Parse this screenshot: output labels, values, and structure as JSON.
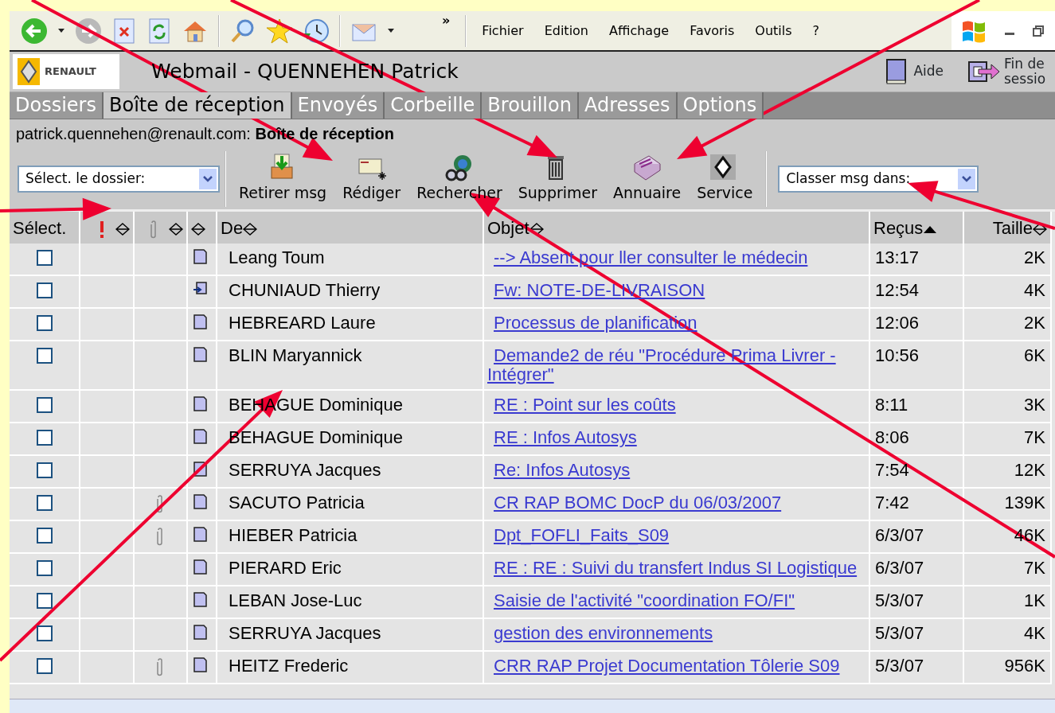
{
  "browser": {
    "menu": [
      "Fichier",
      "Edition",
      "Affichage",
      "Favoris",
      "Outils",
      "?"
    ],
    "chevron": "»"
  },
  "header": {
    "logo": "RENAULT",
    "title": "Webmail - QUENNEHEN Patrick",
    "help": "Aide",
    "logout": "Fin de sessio"
  },
  "tabs": [
    {
      "label": "Dossiers",
      "selected": false
    },
    {
      "label": "Boîte de réception",
      "selected": true
    },
    {
      "label": "Envoyés",
      "selected": false
    },
    {
      "label": "Corbeille",
      "selected": false
    },
    {
      "label": "Brouillon",
      "selected": false
    },
    {
      "label": "Adresses",
      "selected": false
    },
    {
      "label": "Options",
      "selected": false
    }
  ],
  "location": "patrick.quennehen@renault.com: **Boîte de réception**",
  "toolbar": {
    "folder_select": "Sélect. le dossier:",
    "buttons": [
      {
        "kind": "retrieve",
        "label": "Retirer msg"
      },
      {
        "kind": "compose",
        "label": "Rédiger"
      },
      {
        "kind": "search",
        "label": "Rechercher"
      },
      {
        "kind": "delete",
        "label": "Supprimer"
      },
      {
        "kind": "directory",
        "label": "Annuaire"
      },
      {
        "kind": "service",
        "label": "Service"
      }
    ],
    "move_select": "Classer msg dans:"
  },
  "table": {
    "columns": [
      {
        "kind": "select",
        "label": "Sélect."
      },
      {
        "kind": "priority",
        "sorted": false
      },
      {
        "kind": "attachment",
        "sorted": false
      },
      {
        "kind": "icon",
        "sorted": false
      },
      {
        "kind": "text",
        "label": "De",
        "sorted": false
      },
      {
        "kind": "text",
        "label": "Objet",
        "sorted": false
      },
      {
        "kind": "text",
        "label": "Reçus",
        "sorted": true
      },
      {
        "kind": "text",
        "label": "Taille",
        "sorted": false
      }
    ],
    "rows": [
      {
        "checked": false,
        "attachment": false,
        "kind": "message",
        "from": "Leang Toum",
        "subject": "--> Absent pour ller consulter le médecin",
        "received": "13:17",
        "size": "2K"
      },
      {
        "checked": false,
        "attachment": false,
        "kind": "forwarded",
        "from": "CHUNIAUD Thierry",
        "subject": "Fw: NOTE-DE-LIVRAISON",
        "received": "12:54",
        "size": "4K"
      },
      {
        "checked": false,
        "attachment": false,
        "kind": "message",
        "from": "HEBREARD Laure",
        "subject": "Processus de planification",
        "received": "12:06",
        "size": "2K"
      },
      {
        "checked": false,
        "attachment": false,
        "kind": "message",
        "from": "BLIN Maryannick",
        "subject": " Demande2 de réu \"Procédure Prima Livrer - Intégrer\"",
        "received": "10:56",
        "size": "6K"
      },
      {
        "checked": false,
        "attachment": false,
        "kind": "message",
        "from": "BEHAGUE Dominique",
        "subject": "RE : Point sur les coûts",
        "received": "8:11",
        "size": "3K"
      },
      {
        "checked": false,
        "attachment": false,
        "kind": "message",
        "from": "BEHAGUE Dominique",
        "subject": "RE : Infos Autosys",
        "received": "8:06",
        "size": "7K"
      },
      {
        "checked": false,
        "attachment": false,
        "kind": "message",
        "from": "SERRUYA Jacques",
        "subject": "Re: Infos Autosys",
        "received": "7:54",
        "size": "12K"
      },
      {
        "checked": false,
        "attachment": true,
        "kind": "message",
        "from": "SACUTO Patricia",
        "subject": "CR RAP BOMC DocP du 06/03/2007",
        "received": "7:42",
        "size": "139K"
      },
      {
        "checked": false,
        "attachment": true,
        "kind": "message",
        "from": "HIEBER Patricia",
        "subject": "Dpt_FOFLI_Faits_S09",
        "received": "6/3/07",
        "size": "46K"
      },
      {
        "checked": false,
        "attachment": false,
        "kind": "message",
        "from": "PIERARD Eric",
        "subject": "RE : RE : Suivi du transfert Indus SI Logistique",
        "received": "6/3/07",
        "size": "7K"
      },
      {
        "checked": false,
        "attachment": false,
        "kind": "message",
        "from": "LEBAN Jose-Luc",
        "subject": "Saisie de l'activité \"coordination FO/FI\"",
        "received": "5/3/07",
        "size": "1K"
      },
      {
        "checked": false,
        "attachment": false,
        "kind": "message",
        "from": "SERRUYA Jacques",
        "subject": "gestion des environnements",
        "received": "5/3/07",
        "size": "4K"
      },
      {
        "checked": false,
        "attachment": true,
        "kind": "message",
        "from": "HEITZ Frederic",
        "subject": "CRR RAP Projet Documentation Tôlerie S09",
        "received": "5/3/07",
        "size": "956K"
      }
    ]
  }
}
